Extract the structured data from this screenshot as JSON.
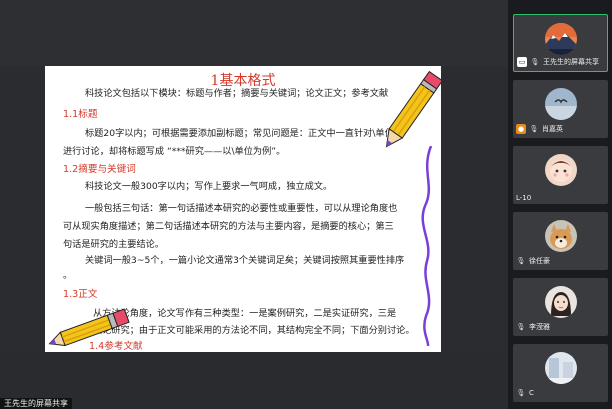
{
  "slide": {
    "title": "1基本格式",
    "intro": "科技论文包括以下模块：标题与作者；摘要与关键词；论文正文；参考文献",
    "sections": [
      {
        "heading": "1.1标题",
        "lines": [
          "标题20字以内；可根据需要添加副标题；常见问题是：正文中一直针对\\单位",
          "进行讨论，却将标题写成 “***研究——以\\单位为例”。"
        ]
      },
      {
        "heading": "1.2摘要与关键词",
        "lines": [
          "科技论文一般300字以内；写作上要求一气呵成，独立成文。",
          "一般包括三句话：第一句话描述本研究的必要性或重要性，可以从理论角度也",
          "可从现实角度描述；第二句话描述本研究的方法与主要内容，是摘要的核心；第三",
          "句话是研究的主要结论。",
          "关键词一般3~5个，一篇小论文通常3个关键词足矣；关键词按照其重要性排序",
          "。"
        ]
      },
      {
        "heading": "1.3正文",
        "lines": [
          "从方法论角度，论文写作有三种类型：一是案例研究，二是实证研究，三是",
          "理论研究；由于正文可能采用的方法论不同，其结构完全不同；下面分别讨论。"
        ]
      },
      {
        "heading": "1.4参考文献"
      }
    ]
  },
  "share_label": "王先生的屏幕共享",
  "participants": [
    {
      "name": "王先生的屏幕共享",
      "avatar": "mountain-landscape",
      "active": true,
      "badge": "screen"
    },
    {
      "name": "肖嘉英",
      "avatar": "sky-bird",
      "active": false,
      "badge": "user"
    },
    {
      "name": "",
      "avatar": "cartoon-face",
      "active": false,
      "badge": "",
      "side_label": "L-10"
    },
    {
      "name": "徐任豪",
      "avatar": "shiba-dog",
      "active": false,
      "badge": "mic"
    },
    {
      "name": "李滢雅",
      "avatar": "girl-portrait",
      "active": false,
      "badge": "mic"
    },
    {
      "name": "C",
      "avatar": "room-photo",
      "active": false,
      "badge": "mic"
    }
  ]
}
